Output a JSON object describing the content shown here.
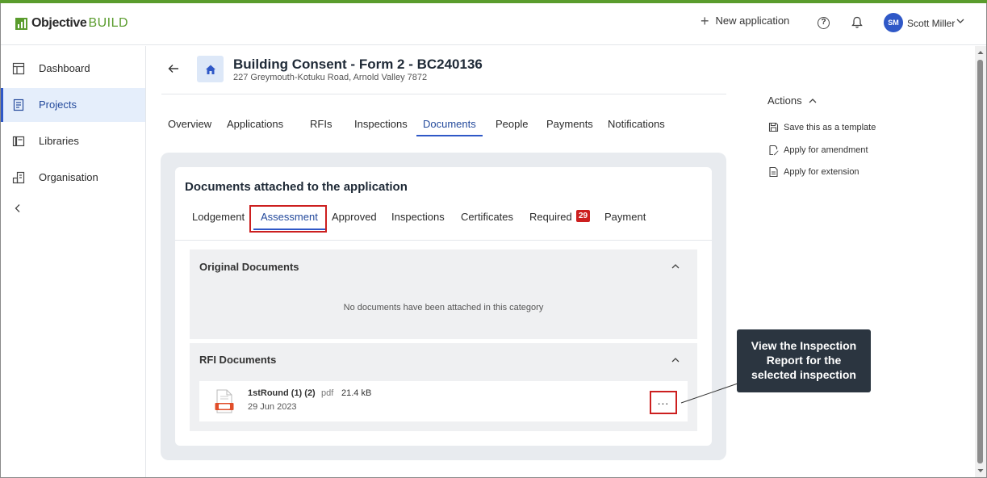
{
  "brand": {
    "name": "Objective",
    "product": "BUILD",
    "accent_color": "#5a9c2d"
  },
  "header": {
    "new_application": "New application",
    "help_icon": "help-circle-icon",
    "notifications_icon": "bell-icon",
    "user": {
      "initials": "SM",
      "name": "Scott Miller"
    }
  },
  "sidebar": {
    "items": [
      {
        "label": "Dashboard",
        "icon": "dashboard-icon"
      },
      {
        "label": "Projects",
        "icon": "projects-icon",
        "active": true
      },
      {
        "label": "Libraries",
        "icon": "libraries-icon"
      },
      {
        "label": "Organisation",
        "icon": "organisation-icon"
      }
    ],
    "collapse_icon": "chevron-left-icon"
  },
  "application": {
    "title": "Building Consent - Form 2 - BC240136",
    "address": "227 Greymouth-Kotuku Road, Arnold Valley 7872"
  },
  "tabs": [
    "Overview",
    "Applications",
    "RFIs",
    "Inspections",
    "Documents",
    "People",
    "Payments",
    "Notifications"
  ],
  "active_tab": "Documents",
  "documents": {
    "heading": "Documents attached to the application",
    "subtabs": [
      "Lodgement",
      "Assessment",
      "Approved",
      "Inspections",
      "Certificates",
      "Required",
      "Payment"
    ],
    "active_subtab": "Assessment",
    "required_count": "29",
    "sections": {
      "original": {
        "title": "Original Documents",
        "empty_message": "No documents have been attached in this category"
      },
      "rfi": {
        "title": "RFI Documents",
        "file": {
          "name": "1stRound (1) (2)",
          "type": "pdf",
          "size": "21.4 kB",
          "date": "29 Jun 2023",
          "menu": "..."
        }
      }
    }
  },
  "actions": {
    "title": "Actions",
    "items": [
      "Save this as a template",
      "Apply for amendment",
      "Apply for extension"
    ]
  },
  "callout": {
    "lines": [
      "View the Inspection",
      "Report for the",
      "selected inspection"
    ]
  },
  "colors": {
    "primary": "#2f58c7",
    "highlight": "#cc1f1f",
    "callout_bg": "#2b3540"
  }
}
